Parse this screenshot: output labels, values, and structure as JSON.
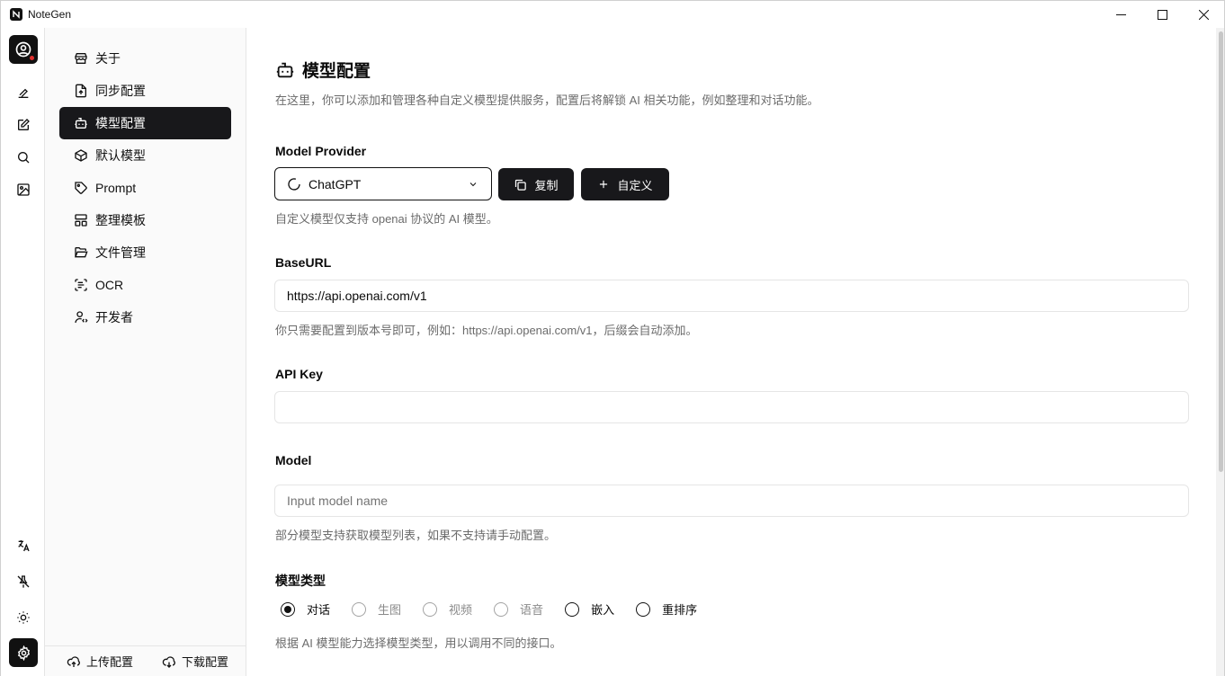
{
  "window": {
    "title": "NoteGen",
    "app_icon": "note-icon"
  },
  "nav": {
    "items": [
      {
        "label": "关于",
        "icon": "store-icon"
      },
      {
        "label": "同步配置",
        "icon": "file-sync-icon"
      },
      {
        "label": "模型配置",
        "icon": "bot-icon",
        "active": true
      },
      {
        "label": "默认模型",
        "icon": "box-icon"
      },
      {
        "label": "Prompt",
        "icon": "tag-icon"
      },
      {
        "label": "整理模板",
        "icon": "layout-icon"
      },
      {
        "label": "文件管理",
        "icon": "folder-open-icon"
      },
      {
        "label": "OCR",
        "icon": "scan-text-icon"
      },
      {
        "label": "开发者",
        "icon": "user-code-icon"
      }
    ],
    "footer": {
      "upload_label": "上传配置",
      "download_label": "下载配置"
    }
  },
  "page": {
    "title": "模型配置",
    "description": "在这里，你可以添加和管理各种自定义模型提供服务，配置后将解锁 AI 相关功能，例如整理和对话功能。"
  },
  "provider": {
    "label": "Model Provider",
    "selected": "ChatGPT",
    "copy_label": "复制",
    "custom_label": "自定义",
    "hint": "自定义模型仅支持 openai 协议的 AI 模型。"
  },
  "baseurl": {
    "label": "BaseURL",
    "value": "https://api.openai.com/v1",
    "hint": "你只需要配置到版本号即可，例如：https://api.openai.com/v1，后缀会自动添加。"
  },
  "apikey": {
    "label": "API Key",
    "value": ""
  },
  "model": {
    "label": "Model",
    "placeholder": "Input model name",
    "hint": "部分模型支持获取模型列表，如果不支持请手动配置。"
  },
  "model_type": {
    "label": "模型类型",
    "options": [
      {
        "label": "对话",
        "checked": true,
        "disabled": false
      },
      {
        "label": "生图",
        "checked": false,
        "disabled": true
      },
      {
        "label": "视频",
        "checked": false,
        "disabled": true
      },
      {
        "label": "语音",
        "checked": false,
        "disabled": true
      },
      {
        "label": "嵌入",
        "checked": false,
        "disabled": false
      },
      {
        "label": "重排序",
        "checked": false,
        "disabled": false
      }
    ],
    "hint": "根据 AI 模型能力选择模型类型，用以调用不同的接口。"
  },
  "colors": {
    "accent": "#18181b",
    "notification": "#e0302e",
    "muted_text": "#6b6b6b"
  }
}
